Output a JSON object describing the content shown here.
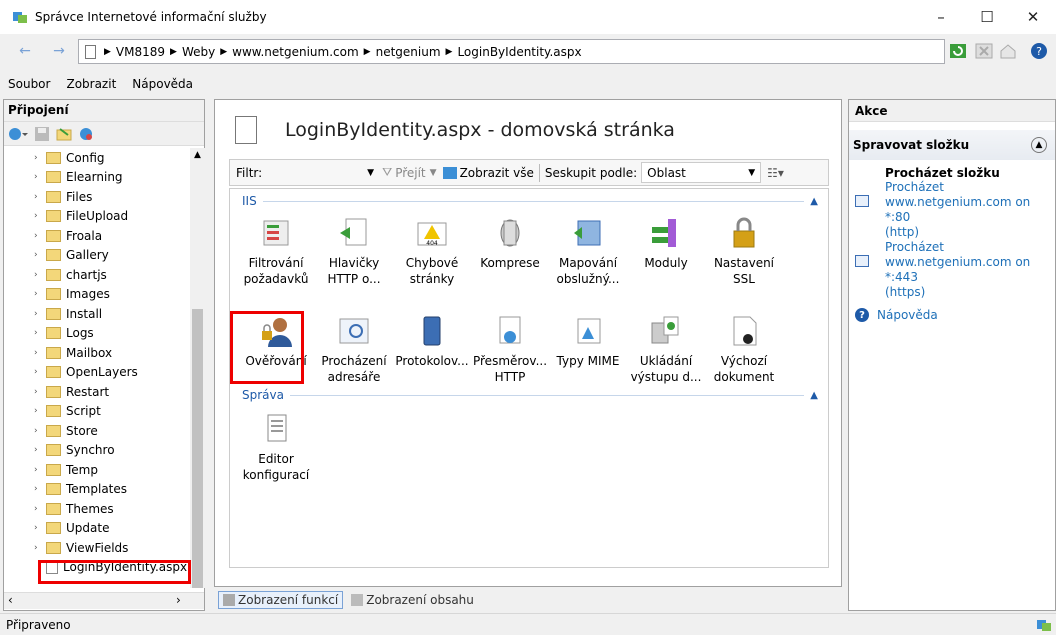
{
  "window": {
    "title": "Správce Internetové informační služby",
    "minimize": "–",
    "maximize": "☐",
    "close": "✕"
  },
  "address": {
    "segments": [
      "VM8189",
      "Weby",
      "www.netgenium.com",
      "netgenium",
      "LoginByIdentity.aspx"
    ]
  },
  "menu": {
    "items": [
      "Soubor",
      "Zobrazit",
      "Nápověda"
    ]
  },
  "connections": {
    "title": "Připojení",
    "tree": [
      "Config",
      "Elearning",
      "Files",
      "FileUpload",
      "Froala",
      "Gallery",
      "chartjs",
      "Images",
      "Install",
      "Logs",
      "Mailbox",
      "OpenLayers",
      "Restart",
      "Script",
      "Store",
      "Synchro",
      "Temp",
      "Templates",
      "Themes",
      "Update",
      "ViewFields"
    ],
    "selected": "LoginByIdentity.aspx"
  },
  "center": {
    "title": "LoginByIdentity.aspx - domovská stránka",
    "filter_label": "Filtr:",
    "go_label": "Přejít",
    "show_all_label": "Zobrazit vše",
    "group_by_label": "Seskupit podle:",
    "group_by_value": "Oblast",
    "groups": [
      {
        "name": "IIS"
      },
      {
        "name": "Správa"
      }
    ],
    "iis_features": [
      {
        "label": "Filtrování požadavků"
      },
      {
        "label": "Hlavičky HTTP o..."
      },
      {
        "label": "Chybové stránky"
      },
      {
        "label": "Komprese"
      },
      {
        "label": "Mapování obslužný..."
      },
      {
        "label": "Moduly"
      },
      {
        "label": "Nastavení SSL"
      },
      {
        "label": "Ověřování"
      },
      {
        "label": "Procházení adresáře"
      },
      {
        "label": "Protokolov..."
      },
      {
        "label": "Přesměrov... HTTP"
      },
      {
        "label": "Typy MIME"
      },
      {
        "label": "Ukládání výstupu d..."
      },
      {
        "label": "Výchozí dokument"
      }
    ],
    "sprava_features": [
      {
        "label": "Editor konfigurací"
      }
    ],
    "bottom_tabs": [
      "Zobrazení funkcí",
      "Zobrazení obsahu"
    ]
  },
  "actions": {
    "title": "Akce",
    "section": "Spravovat složku",
    "browse_title": "Procházet složku",
    "browse1_a": "Procházet",
    "browse1_b": "www.netgenium.com on *:80",
    "browse1_c": "(http)",
    "browse2_a": "Procházet",
    "browse2_b": "www.netgenium.com on *:443",
    "browse2_c": "(https)",
    "help": "Nápověda"
  },
  "status": {
    "text": "Připraveno"
  },
  "colors": {
    "accent": "#1e70b8",
    "highlight": "#ee0000",
    "folder": "#f3d77a"
  }
}
